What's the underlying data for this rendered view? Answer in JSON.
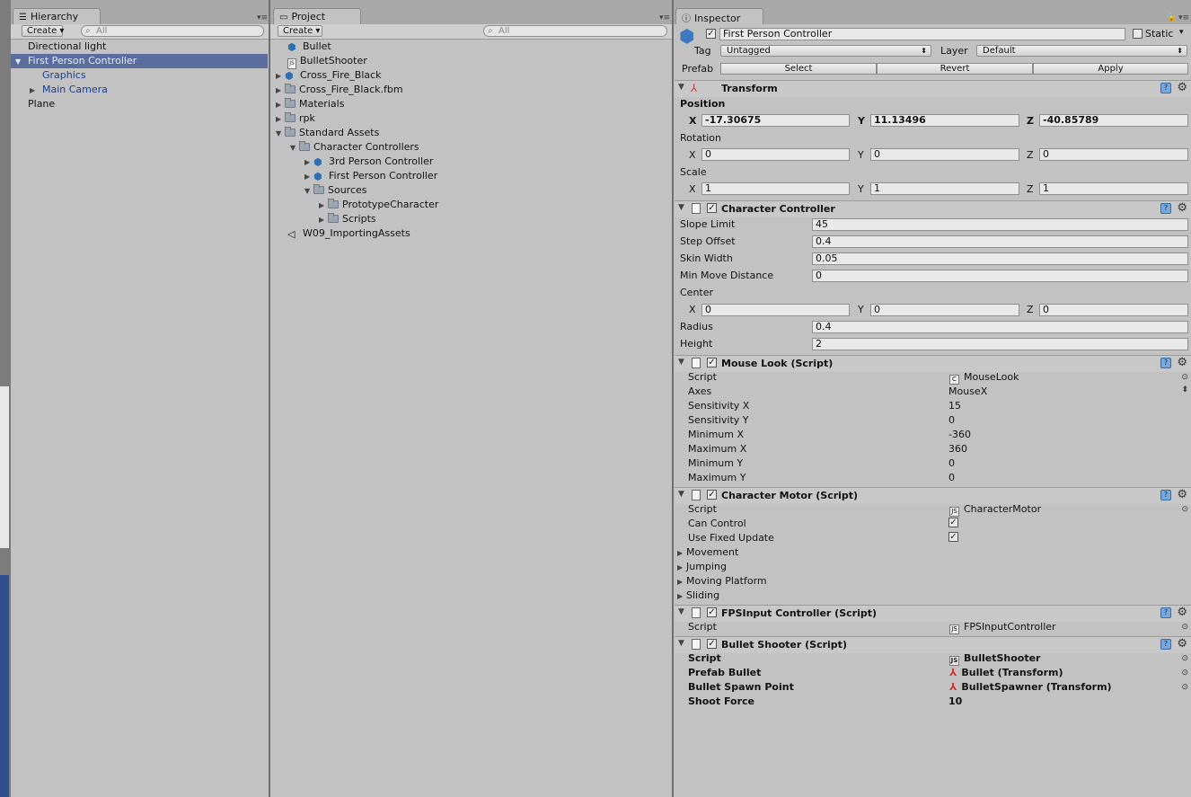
{
  "hierarchy": {
    "tab_label": "Hierarchy",
    "create_label": "Create",
    "search_placeholder": "All",
    "items": [
      {
        "label": "Directional light"
      },
      {
        "label": "First Person Controller"
      },
      {
        "label": "Graphics"
      },
      {
        "label": "Main Camera"
      },
      {
        "label": "Plane"
      }
    ]
  },
  "project": {
    "tab_label": "Project",
    "create_label": "Create",
    "search_placeholder": "All",
    "items": [
      {
        "label": "Bullet",
        "icon": "prefab-icon"
      },
      {
        "label": "BulletShooter",
        "icon": "script-icon"
      },
      {
        "label": "Cross_Fire_Black",
        "icon": "prefab-icon"
      },
      {
        "label": "Cross_Fire_Black.fbm",
        "icon": "folder-icon"
      },
      {
        "label": "Materials",
        "icon": "folder-icon"
      },
      {
        "label": "rpk",
        "icon": "folder-icon"
      },
      {
        "label": "Standard Assets",
        "icon": "folder-icon"
      },
      {
        "label": "Character Controllers",
        "icon": "folder-icon"
      },
      {
        "label": "3rd Person Controller",
        "icon": "prefab-icon"
      },
      {
        "label": "First Person Controller",
        "icon": "prefab-icon"
      },
      {
        "label": "Sources",
        "icon": "folder-icon"
      },
      {
        "label": "PrototypeCharacter",
        "icon": "folder-icon"
      },
      {
        "label": "Scripts",
        "icon": "folder-icon"
      },
      {
        "label": "W09_ImportingAssets",
        "icon": "unity-scene-icon"
      }
    ]
  },
  "inspector": {
    "tab_label": "Inspector",
    "object_name": "First Person Controller",
    "static_label": "Static",
    "tag_label": "Tag",
    "tag_value": "Untagged",
    "layer_label": "Layer",
    "layer_value": "Default",
    "prefab_label": "Prefab",
    "prefab_buttons": {
      "select": "Select",
      "revert": "Revert",
      "apply": "Apply"
    },
    "transform": {
      "title": "Transform",
      "position_label": "Position",
      "position": {
        "x": "-17.30675",
        "y": "11.13496",
        "z": "-40.85789"
      },
      "rotation_label": "Rotation",
      "rotation": {
        "x": "0",
        "y": "0",
        "z": "0"
      },
      "scale_label": "Scale",
      "scale": {
        "x": "1",
        "y": "1",
        "z": "1"
      }
    },
    "axis_labels": {
      "x": "X",
      "y": "Y",
      "z": "Z"
    },
    "character_controller": {
      "title": "Character Controller",
      "slope_limit_label": "Slope Limit",
      "slope_limit": "45",
      "step_offset_label": "Step Offset",
      "step_offset": "0.4",
      "skin_width_label": "Skin Width",
      "skin_width": "0.05",
      "min_move_label": "Min Move Distance",
      "min_move": "0",
      "center_label": "Center",
      "center": {
        "x": "0",
        "y": "0",
        "z": "0"
      },
      "radius_label": "Radius",
      "radius": "0.4",
      "height_label": "Height",
      "height": "2"
    },
    "mouse_look": {
      "title": "Mouse Look (Script)",
      "rows": [
        {
          "label": "Script",
          "value": "MouseLook"
        },
        {
          "label": "Axes",
          "value": "MouseX"
        },
        {
          "label": "Sensitivity X",
          "value": "15"
        },
        {
          "label": "Sensitivity Y",
          "value": "0"
        },
        {
          "label": "Minimum X",
          "value": "-360"
        },
        {
          "label": "Maximum X",
          "value": "360"
        },
        {
          "label": "Minimum Y",
          "value": "0"
        },
        {
          "label": "Maximum Y",
          "value": "0"
        }
      ]
    },
    "character_motor": {
      "title": "Character Motor (Script)",
      "script_label": "Script",
      "script_value": "CharacterMotor",
      "can_control_label": "Can Control",
      "can_control": true,
      "fixed_update_label": "Use Fixed Update",
      "fixed_update": true,
      "foldouts": [
        "Movement",
        "Jumping",
        "Moving Platform",
        "Sliding"
      ]
    },
    "fps_input": {
      "title": "FPSInput Controller (Script)",
      "script_label": "Script",
      "script_value": "FPSInputController"
    },
    "bullet_shooter": {
      "title": "Bullet Shooter (Script)",
      "rows": [
        {
          "label": "Script",
          "value": "BulletShooter"
        },
        {
          "label": "Prefab Bullet",
          "value": "Bullet (Transform)"
        },
        {
          "label": "Bullet Spawn Point",
          "value": "BulletSpawner (Transform)"
        },
        {
          "label": "Shoot Force",
          "value": "10"
        }
      ]
    }
  },
  "colors": {
    "selection": "#5a6d9c",
    "scene_blue": "#2f4f8c"
  }
}
